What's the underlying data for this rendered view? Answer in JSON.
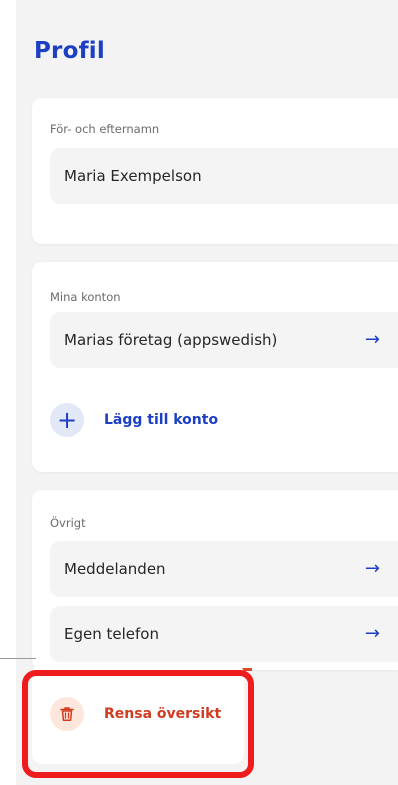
{
  "header": {
    "title": "Profil"
  },
  "name_section": {
    "label": "För- och efternamn",
    "value": "Maria Exempelson"
  },
  "accounts_section": {
    "label": "Mina konton",
    "accounts": [
      {
        "label": "Marias företag (appswedish)"
      }
    ],
    "add_label": "Lägg till konto"
  },
  "other_section": {
    "label": "Övrigt",
    "items": [
      {
        "label": "Meddelanden"
      },
      {
        "label": "Egen telefon"
      }
    ]
  },
  "clear_action": {
    "label": "Rensa översikt"
  },
  "icons": {
    "arrow": "arrow-right-icon",
    "add": "plus-icon",
    "clear": "trash-icon"
  },
  "colors": {
    "accent": "#1c3fc4",
    "danger": "#d23a1f",
    "highlight": "#ee1c1c"
  }
}
